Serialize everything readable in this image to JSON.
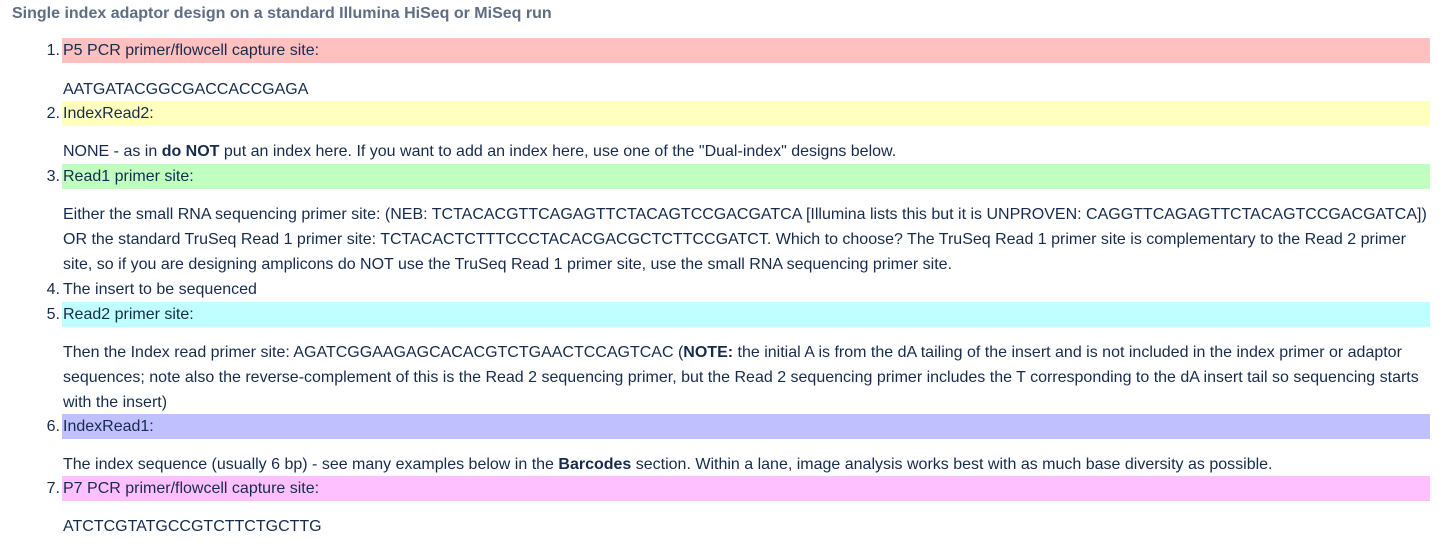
{
  "heading": "Single index adaptor design on a standard Illumina HiSeq or MiSeq run",
  "items": [
    {
      "number": "1.",
      "label": "P5 PCR primer/flowcell capture site:",
      "color": "#ffc0c0",
      "desc": [
        "AATGATACGGCGACCACCGAGA"
      ]
    },
    {
      "number": "2.",
      "label": "IndexRead2:",
      "color": "#ffffc0",
      "desc": [
        "NONE - as in ",
        "do NOT",
        " put an index here.  If you want to add an index here, use one of the \"Dual-index\" designs below."
      ]
    },
    {
      "number": "3.",
      "label": "Read1 primer site:",
      "color": "#c0ffc0",
      "desc": [
        "Either the small RNA sequencing primer site: (NEB: TCTACACGTTCAGAGTTCTACAGTCCGACGATCA [Illumina lists this but it is UNPROVEN: CAGGTTCAGAGTTCTACAGTCCGACGATCA]) OR the standard TruSeq Read 1 primer site: TCTACACTCTTTCCCTACACGACGCTCTTCCGATCT. Which to choose? The TruSeq Read 1 primer site is complementary to the Read 2 primer site, so if you are designing amplicons do NOT use the TruSeq Read 1 primer site, use the small RNA sequencing primer site."
      ]
    },
    {
      "number": "4.",
      "label": "The insert to be sequenced",
      "color": "",
      "desc": []
    },
    {
      "number": "5.",
      "label": "Read2 primer site:",
      "color": "#c0ffff",
      "desc": [
        "Then the Index read primer site: AGATCGGAAGAGCACACGTCTGAACTCCAGTCAC (",
        "NOTE:",
        " the initial A is from the dA tailing of the insert and is not included in the index primer or adaptor sequences; note also the reverse-complement of this is the Read 2 sequencing primer, but the Read 2 sequencing primer includes the T corresponding to the dA insert tail so sequencing starts with the insert)"
      ]
    },
    {
      "number": "6.",
      "label": "IndexRead1:",
      "color": "#c0c0ff",
      "desc": [
        "The index sequence (usually 6 bp) - see many examples below in the ",
        "Barcodes",
        " section. Within a lane, image analysis works best with as much base diversity as possible."
      ]
    },
    {
      "number": "7.",
      "label": "P7 PCR primer/flowcell capture site:",
      "color": "#ffc0ff",
      "desc": [
        "ATCTCGTATGCCGTCTTCTGCTTG"
      ]
    }
  ]
}
